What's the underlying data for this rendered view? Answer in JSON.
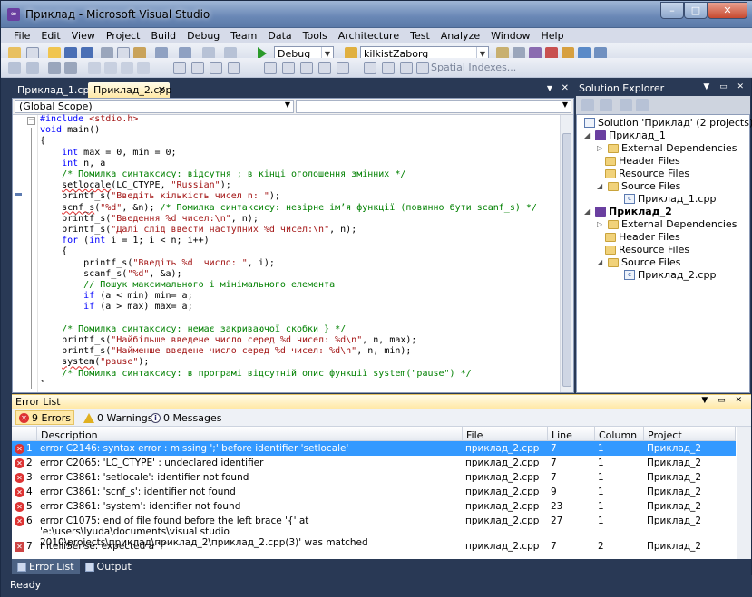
{
  "window": {
    "title": "Приклад - Microsoft Visual Studio"
  },
  "menu": [
    "File",
    "Edit",
    "View",
    "Project",
    "Build",
    "Debug",
    "Team",
    "Data",
    "Tools",
    "Architecture",
    "Test",
    "Analyze",
    "Window",
    "Help"
  ],
  "toolbar": {
    "config": "Debug",
    "platform_combo": "kilkistZaborg",
    "spatial": "Spatial Indexes..."
  },
  "tabs": [
    {
      "label": "Приклад_1.cpp"
    },
    {
      "label": "Приклад_2.cpp"
    }
  ],
  "editor": {
    "scope": "(Global Scope)",
    "lines": [
      "#include <stdio.h>",
      "void main()",
      "{",
      "    int max = 0, min = 0;",
      "    int n, a",
      "    /* Помилка синтаксису: відсутня ; в кінці оголошення змінних */",
      "    setlocale(LC_CTYPE, \"Russian\");",
      "    printf_s(\"Введіть кількість чисел n: \");",
      "    scnf_s(\"%d\", &n); /* Помилка синтаксису: невірне ім’я функції (повинно бути scanf_s) */",
      "    printf_s(\"Введення %d чисел:\\n\", n);",
      "    printf_s(\"Далі слід ввести наступних %d чисел:\\n\", n);",
      "    for (int i = 1; i < n; i++)",
      "    {",
      "        printf_s(\"Введіть %d  число: \", i);",
      "        scanf_s(\"%d\", &a);",
      "        // Пошук максимального і мінімального елемента",
      "        if (a < min) min= a;",
      "        if (a > max) max= a;",
      "",
      "    /* Помилка синтаксису: немає закриваючої скобки } */",
      "    printf_s(\"Найбільше введене число серед %d чисел: %d\\n\", n, max);",
      "    printf_s(\"Найменше введене число серед %d чисел: %d\\n\", n, min);",
      "    system(\"pause\");",
      "    /* Помилка синтаксису: в програмі відсутній опис функції system(\"pause\") */",
      "}"
    ]
  },
  "solution_explorer": {
    "title": "Solution Explorer",
    "solution": "Solution 'Приклад' (2 projects)",
    "project1": {
      "name": "Приклад_1",
      "ext": "External Dependencies",
      "hdr": "Header Files",
      "res": "Resource Files",
      "src": "Source Files",
      "file": "Приклад_1.cpp"
    },
    "project2": {
      "name": "Приклад_2",
      "ext": "External Dependencies",
      "hdr": "Header Files",
      "res": "Resource Files",
      "src": "Source Files",
      "file": "Приклад_2.cpp"
    }
  },
  "error_list": {
    "title": "Error List",
    "errors_btn": "9 Errors",
    "warnings_btn": "0 Warnings",
    "messages_btn": "0 Messages",
    "columns": {
      "description": "Description",
      "file": "File",
      "line": "Line",
      "column": "Column",
      "project": "Project"
    },
    "rows": [
      {
        "n": "1",
        "desc": "error C2146: syntax error : missing ';' before identifier 'setlocale'",
        "file": "приклад_2.cpp",
        "line": "7",
        "col": "1",
        "project": "Приклад_2"
      },
      {
        "n": "2",
        "desc": "error C2065: 'LC_CTYPE' : undeclared identifier",
        "file": "приклад_2.cpp",
        "line": "7",
        "col": "1",
        "project": "Приклад_2"
      },
      {
        "n": "3",
        "desc": "error C3861: 'setlocale': identifier not found",
        "file": "приклад_2.cpp",
        "line": "7",
        "col": "1",
        "project": "Приклад_2"
      },
      {
        "n": "4",
        "desc": "error C3861: 'scnf_s': identifier not found",
        "file": "приклад_2.cpp",
        "line": "9",
        "col": "1",
        "project": "Приклад_2"
      },
      {
        "n": "5",
        "desc": "error C3861: 'system': identifier not found",
        "file": "приклад_2.cpp",
        "line": "23",
        "col": "1",
        "project": "Приклад_2"
      },
      {
        "n": "6",
        "desc": "error C1075: end of file found before the left brace '{' at 'e:\\users\\lyuda\\documents\\visual studio 2010\\projects\\приклад\\приклад_2\\приклад_2.cpp(3)' was matched",
        "file": "приклад_2.cpp",
        "line": "27",
        "col": "1",
        "project": "Приклад_2"
      },
      {
        "n": "7",
        "desc": "IntelliSense: expected a ';'",
        "file": "приклад_2.cpp",
        "line": "7",
        "col": "2",
        "project": "Приклад_2"
      }
    ]
  },
  "bottom_tabs": {
    "error_list": "Error List",
    "output": "Output"
  },
  "status": "Ready"
}
